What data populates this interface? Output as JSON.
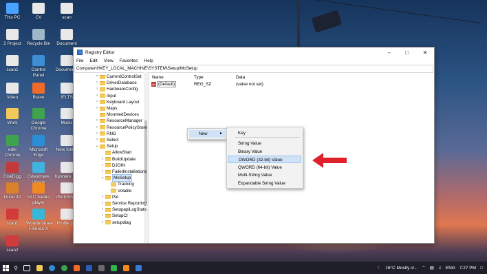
{
  "desktop_icons": [
    {
      "label": "This PC",
      "color": "#4aa3ff"
    },
    {
      "label": "CV",
      "color": "#e8e8e8"
    },
    {
      "label": "scan",
      "color": "#e8e8e8"
    },
    {
      "label": "2 Project",
      "color": "#e8e8e8"
    },
    {
      "label": "Recycle Bin",
      "color": "#9fb7c9"
    },
    {
      "label": "Document",
      "color": "#e8e8e8"
    },
    {
      "label": "scan1",
      "color": "#e8e8e8"
    },
    {
      "label": "Control Panel",
      "color": "#3e8ed6"
    },
    {
      "label": "Documents",
      "color": "#e8e8e8"
    },
    {
      "label": "Video",
      "color": "#e8e8e8"
    },
    {
      "label": "Brave",
      "color": "#f06a2a"
    },
    {
      "label": "IELTS",
      "color": "#e8e8e8"
    },
    {
      "label": "Work",
      "color": "#f3c95a"
    },
    {
      "label": "Google Chrome",
      "color": "#3fa34d"
    },
    {
      "label": "Music",
      "color": "#e8e8e8"
    },
    {
      "label": "edle Chrome",
      "color": "#3fa34d"
    },
    {
      "label": "Microsoft Edge",
      "color": "#2a8fd6"
    },
    {
      "label": "New folder",
      "color": "#e8e8e8"
    },
    {
      "label": "DiskDigg",
      "color": "#c23a3a"
    },
    {
      "label": "Gdesfmare Library",
      "color": "#3fb4e0"
    },
    {
      "label": "Kyshare Lib",
      "color": "#e8e8e8"
    },
    {
      "label": "Dune 32",
      "color": "#d9822b"
    },
    {
      "label": "VLC media player",
      "color": "#f08a1e"
    },
    {
      "label": "PhotoShop",
      "color": "#e8e8e8"
    },
    {
      "label": "scan1",
      "color": "#d23b3b"
    },
    {
      "label": "Wondershare Filmora X",
      "color": "#35b7d8"
    },
    {
      "label": "Profile pic",
      "color": "#e8e8e8"
    },
    {
      "label": "scan2",
      "color": "#d23b3b"
    }
  ],
  "window": {
    "title": "Registry Editor",
    "menu": [
      "File",
      "Edit",
      "View",
      "Favorites",
      "Help"
    ],
    "address": "Computer\\HKEY_LOCAL_MACHINE\\SYSTEM\\Setup\\MoSetup"
  },
  "tree": [
    "CurrentControlSet",
    "DriverDatabase",
    "HardwareConfig",
    "Input",
    "Keyboard Layout",
    "Maps",
    "MountedDevices",
    "ResourceManager",
    "ResourcePolicyStore",
    "RNG",
    "Select",
    "Setup",
    "AllowStart",
    "BuildUpdate",
    "DJOIN",
    "FailedInstallations",
    "MoSetup",
    "Tracking",
    "Volatile",
    "Pid",
    "Service Reporting",
    "SetupapiLogStats",
    "SetupCI",
    "setupdiag"
  ],
  "values": {
    "headers": [
      "Name",
      "Type",
      "Data"
    ],
    "rows": [
      {
        "name": "(Default)",
        "type": "REG_SZ",
        "data": "(value not set)"
      }
    ]
  },
  "context": {
    "new_label": "New",
    "submenu": [
      "Key",
      "String Value",
      "Binary Value",
      "DWORD (32-bit) Value",
      "QWORD (64-bit) Value",
      "Multi-String Value",
      "Expandable String Value"
    ]
  },
  "taskbar": {
    "weather": "16°C  Mostly cl...",
    "lang": "ENG",
    "time": "7:27 PM"
  },
  "colors": {
    "accent": "#cfe2f8",
    "arrow": "#e0202a"
  }
}
